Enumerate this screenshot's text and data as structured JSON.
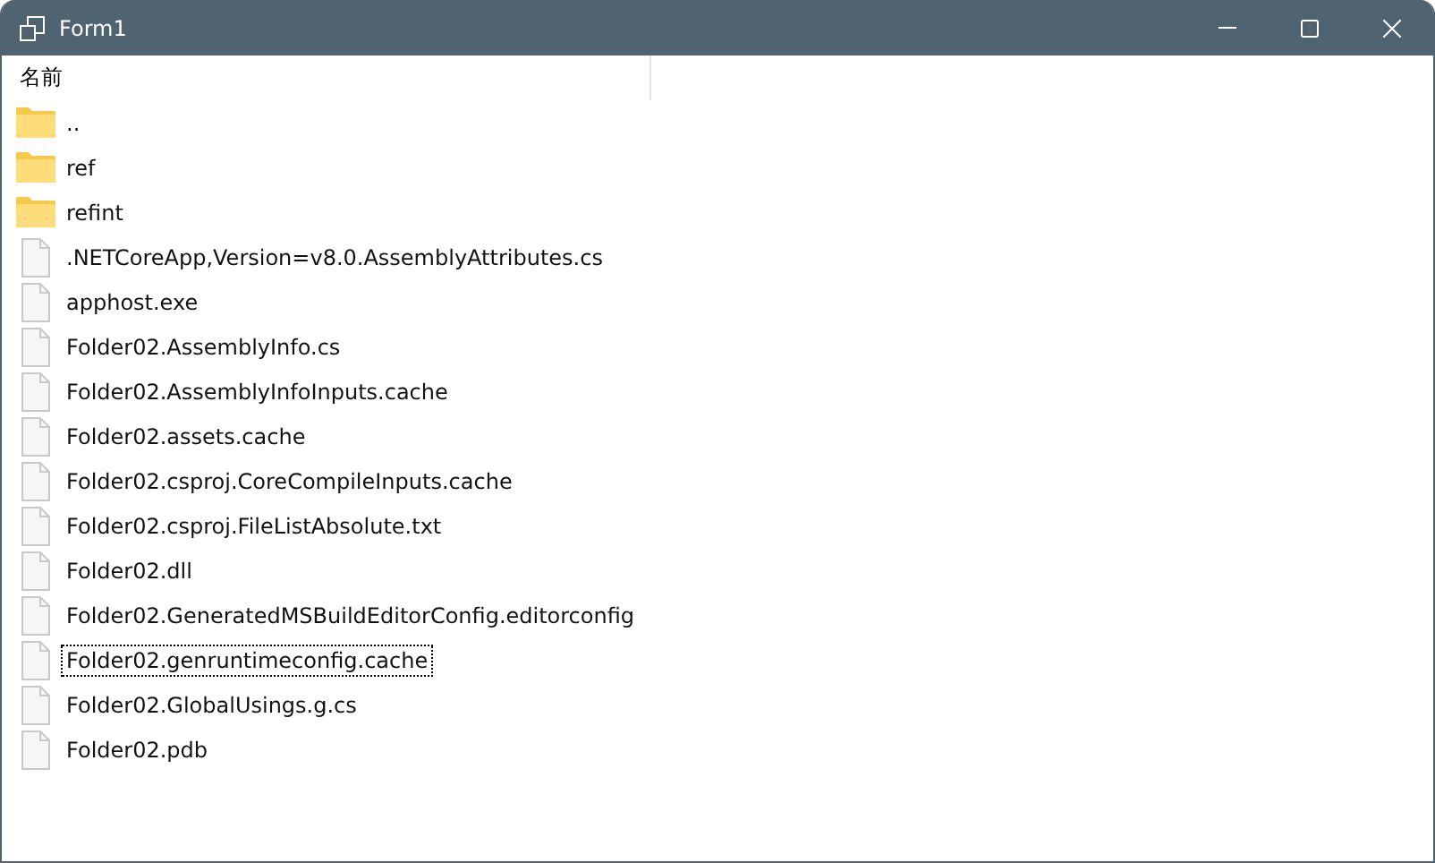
{
  "window": {
    "title": "Form1"
  },
  "list": {
    "column_header": "名前",
    "items": [
      {
        "kind": "folder",
        "name": "..",
        "focused": false
      },
      {
        "kind": "folder",
        "name": "ref",
        "focused": false
      },
      {
        "kind": "folder",
        "name": "refint",
        "focused": false
      },
      {
        "kind": "file",
        "name": ".NETCoreApp,Version=v8.0.AssemblyAttributes.cs",
        "focused": false
      },
      {
        "kind": "file",
        "name": "apphost.exe",
        "focused": false
      },
      {
        "kind": "file",
        "name": "Folder02.AssemblyInfo.cs",
        "focused": false
      },
      {
        "kind": "file",
        "name": "Folder02.AssemblyInfoInputs.cache",
        "focused": false
      },
      {
        "kind": "file",
        "name": "Folder02.assets.cache",
        "focused": false
      },
      {
        "kind": "file",
        "name": "Folder02.csproj.CoreCompileInputs.cache",
        "focused": false
      },
      {
        "kind": "file",
        "name": "Folder02.csproj.FileListAbsolute.txt",
        "focused": false
      },
      {
        "kind": "file",
        "name": "Folder02.dll",
        "focused": false
      },
      {
        "kind": "file",
        "name": "Folder02.GeneratedMSBuildEditorConfig.editorconfig",
        "focused": false
      },
      {
        "kind": "file",
        "name": "Folder02.genruntimeconfig.cache",
        "focused": true
      },
      {
        "kind": "file",
        "name": "Folder02.GlobalUsings.g.cs",
        "focused": false
      },
      {
        "kind": "file",
        "name": "Folder02.pdb",
        "focused": false
      }
    ]
  }
}
